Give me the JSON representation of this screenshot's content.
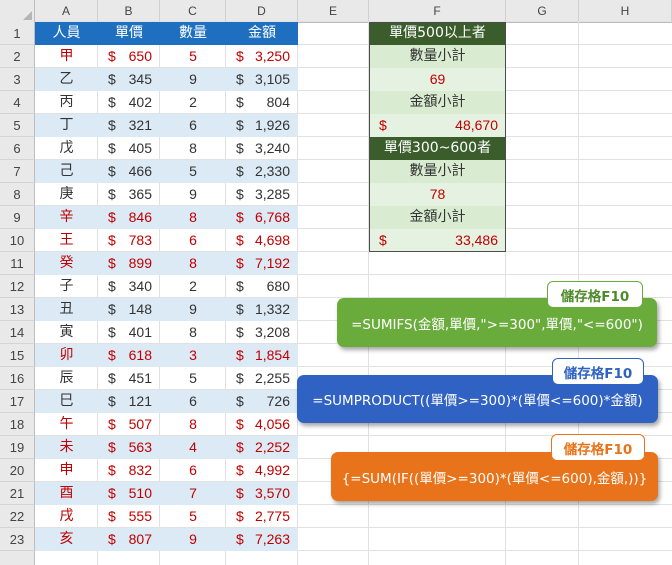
{
  "columns": [
    "A",
    "B",
    "C",
    "D",
    "E",
    "F",
    "G",
    "H"
  ],
  "rows": [
    "1",
    "2",
    "3",
    "4",
    "5",
    "6",
    "7",
    "8",
    "9",
    "10",
    "11",
    "12",
    "13",
    "14",
    "15",
    "16",
    "17",
    "18",
    "19",
    "20",
    "21",
    "22",
    "23"
  ],
  "table": {
    "headers": [
      "人員",
      "單價",
      "數量",
      "金額"
    ],
    "currency": "$",
    "rows": [
      {
        "name": "甲",
        "price": "650",
        "qty": "5",
        "amount": "3,250",
        "highlight": true
      },
      {
        "name": "乙",
        "price": "345",
        "qty": "9",
        "amount": "3,105",
        "highlight": false
      },
      {
        "name": "丙",
        "price": "402",
        "qty": "2",
        "amount": "804",
        "highlight": false
      },
      {
        "name": "丁",
        "price": "321",
        "qty": "6",
        "amount": "1,926",
        "highlight": false
      },
      {
        "name": "戊",
        "price": "405",
        "qty": "8",
        "amount": "3,240",
        "highlight": false
      },
      {
        "name": "己",
        "price": "466",
        "qty": "5",
        "amount": "2,330",
        "highlight": false
      },
      {
        "name": "庚",
        "price": "365",
        "qty": "9",
        "amount": "3,285",
        "highlight": false
      },
      {
        "name": "辛",
        "price": "846",
        "qty": "8",
        "amount": "6,768",
        "highlight": true
      },
      {
        "name": "王",
        "price": "783",
        "qty": "6",
        "amount": "4,698",
        "highlight": true
      },
      {
        "name": "癸",
        "price": "899",
        "qty": "8",
        "amount": "7,192",
        "highlight": true
      },
      {
        "name": "子",
        "price": "340",
        "qty": "2",
        "amount": "680",
        "highlight": false
      },
      {
        "name": "丑",
        "price": "148",
        "qty": "9",
        "amount": "1,332",
        "highlight": false
      },
      {
        "name": "寅",
        "price": "401",
        "qty": "8",
        "amount": "3,208",
        "highlight": false
      },
      {
        "name": "卯",
        "price": "618",
        "qty": "3",
        "amount": "1,854",
        "highlight": true
      },
      {
        "name": "辰",
        "price": "451",
        "qty": "5",
        "amount": "2,255",
        "highlight": false
      },
      {
        "name": "巳",
        "price": "121",
        "qty": "6",
        "amount": "726",
        "highlight": false
      },
      {
        "name": "午",
        "price": "507",
        "qty": "8",
        "amount": "4,056",
        "highlight": true
      },
      {
        "name": "未",
        "price": "563",
        "qty": "4",
        "amount": "2,252",
        "highlight": true
      },
      {
        "name": "申",
        "price": "832",
        "qty": "6",
        "amount": "4,992",
        "highlight": true
      },
      {
        "name": "酉",
        "price": "510",
        "qty": "7",
        "amount": "3,570",
        "highlight": true
      },
      {
        "name": "戌",
        "price": "555",
        "qty": "5",
        "amount": "2,775",
        "highlight": true
      },
      {
        "name": "亥",
        "price": "807",
        "qty": "9",
        "amount": "7,263",
        "highlight": true
      }
    ]
  },
  "summary": {
    "section1_title": "單價500以上者",
    "section1_qty_label": "數量小計",
    "section1_qty_value": "69",
    "section1_amount_label": "金額小計",
    "section1_amount_currency": "$",
    "section1_amount_value": "48,670",
    "section2_title": "單價300~600者",
    "section2_qty_label": "數量小計",
    "section2_qty_value": "78",
    "section2_amount_label": "金額小計",
    "section2_amount_currency": "$",
    "section2_amount_value": "33,486"
  },
  "callouts": [
    {
      "tag": "儲存格F10",
      "formula": "=SUMIFS(金額,單價,\">=300\",單價,\"<=600\")",
      "color": "#6aac3c",
      "tag_color": "#4f8a2a"
    },
    {
      "tag": "儲存格F10",
      "formula": "=SUMPRODUCT((單價>=300)*(單價<=600)*金額)",
      "color": "#2f62c2",
      "tag_color": "#2f62c2"
    },
    {
      "tag": "儲存格F10",
      "formula": "{=SUM(IF((單價>=300)*(單價<=600),金額,))}",
      "color": "#e8731a",
      "tag_color": "#e8731a"
    }
  ],
  "colors": {
    "table_header": "#1f6fc0",
    "table_band": "#dceaf6",
    "highlight_text": "#c00000",
    "summary_title": "#3a5d2b",
    "summary_band": "#d9ecd1"
  }
}
